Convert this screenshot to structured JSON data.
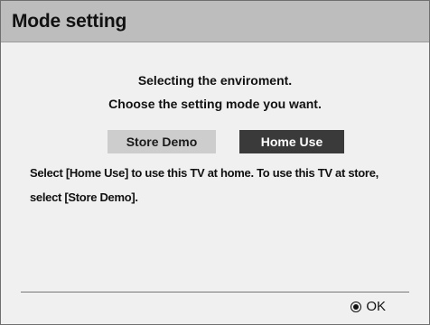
{
  "dialog": {
    "title": "Mode setting",
    "line1": "Selecting the enviroment.",
    "line2": "Choose the setting mode you want.",
    "buttons": {
      "store_demo": "Store Demo",
      "home_use": "Home Use"
    },
    "description": "Select [Home Use] to use this TV at home. To use this TV at store, select [Store Demo].",
    "footer": {
      "ok_label": "OK",
      "ok_icon": "ok-button-icon"
    }
  },
  "colors": {
    "title_bar": "#bdbdbd",
    "body": "#f0f0f0",
    "selected_button": "#3a3a3a",
    "unselected_button": "#cdcdcd"
  },
  "selected_mode": "Home Use"
}
